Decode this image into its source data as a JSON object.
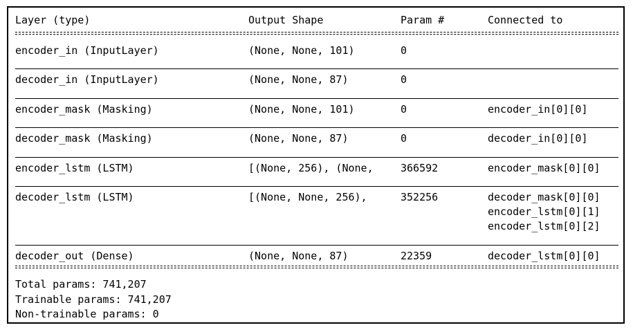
{
  "header": {
    "layer_type": "Layer (type)",
    "output_shape": "Output Shape",
    "param_count": "Param #",
    "connected_to": "Connected to"
  },
  "rows": [
    {
      "layer": "encoder_in (InputLayer)",
      "shape": "(None, None, 101)",
      "params": "0",
      "connected": []
    },
    {
      "layer": "decoder_in (InputLayer)",
      "shape": "(None, None, 87)",
      "params": "0",
      "connected": []
    },
    {
      "layer": "encoder_mask (Masking)",
      "shape": "(None, None, 101)",
      "params": "0",
      "connected": [
        "encoder_in[0][0]"
      ]
    },
    {
      "layer": "decoder_mask (Masking)",
      "shape": "(None, None, 87)",
      "params": "0",
      "connected": [
        "decoder_in[0][0]"
      ]
    },
    {
      "layer": "encoder_lstm (LSTM)",
      "shape": "[(None, 256), (None,",
      "params": "366592",
      "connected": [
        "encoder_mask[0][0]"
      ]
    },
    {
      "layer": "decoder_lstm (LSTM)",
      "shape": "[(None, None, 256),",
      "params": "352256",
      "connected": [
        "decoder_mask[0][0]",
        "encoder_lstm[0][1]",
        "encoder_lstm[0][2]"
      ]
    },
    {
      "layer": "decoder_out (Dense)",
      "shape": "(None, None, 87)",
      "params": "22359",
      "connected": [
        "decoder_lstm[0][0]"
      ]
    }
  ],
  "summary": {
    "total": "Total params: 741,207",
    "trainable": "Trainable params: 741,207",
    "non_trainable": "Non-trainable params: 0"
  }
}
